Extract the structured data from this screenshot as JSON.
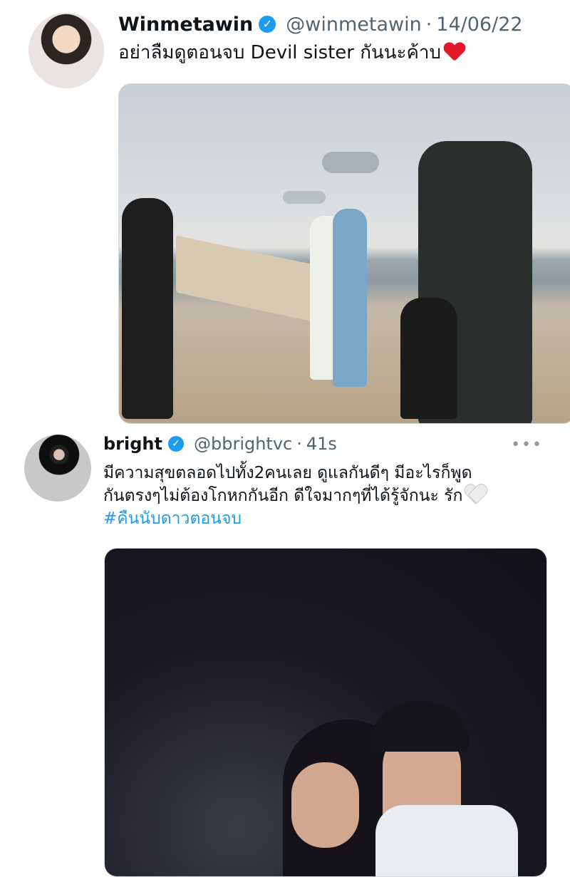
{
  "tweets": [
    {
      "name": "Winmetawin",
      "handle": "@winmetawin",
      "time": "14/06/22",
      "text": "อย่าลืมดูตอนจบ Devil sister กันนะค้าบ",
      "emoji": "red-heart",
      "verified": true
    },
    {
      "name": "bright",
      "handle": "@bbrightvc",
      "time": "41s",
      "text_line1": "มีความสุขตลอดไปทั้ง2คนเลย ดูแลกันดีๆ มีอะไรก็พูด",
      "text_line2": "กันตรงๆไม่ต้องโกหกกันอีก ดีใจมากๆที่ได้รู้จักนะ รัก",
      "emoji": "white-heart",
      "hashtag": "#คืนนับดาวตอนจบ",
      "verified": true,
      "more": "•••"
    }
  ],
  "separator": "·",
  "verified_glyph": "✓"
}
